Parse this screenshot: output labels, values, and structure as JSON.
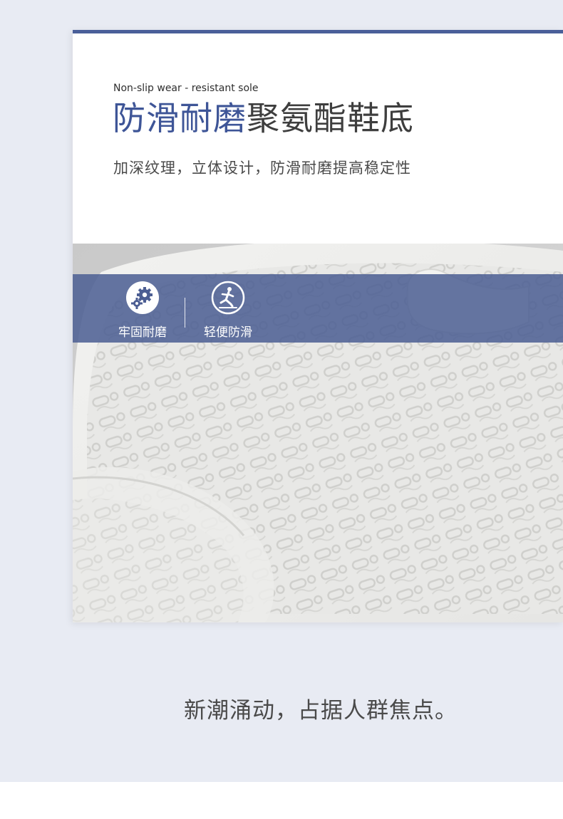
{
  "header": {
    "subtitle_en": "Non-slip wear - resistant sole",
    "title_accent": "防滑耐磨",
    "title_rest": "聚氨酯鞋底",
    "description": "加深纹理，立体设计，防滑耐磨提高稳定性"
  },
  "features": [
    {
      "label": "牢固耐磨",
      "icon": "gear-icon"
    },
    {
      "label": "轻便防滑",
      "icon": "slip-warning-icon"
    }
  ],
  "slogan": "新潮涌动，占据人群焦点。",
  "colors": {
    "accent": "#3e5597",
    "bar": "#4c5e93",
    "background": "#e8ebf3"
  }
}
